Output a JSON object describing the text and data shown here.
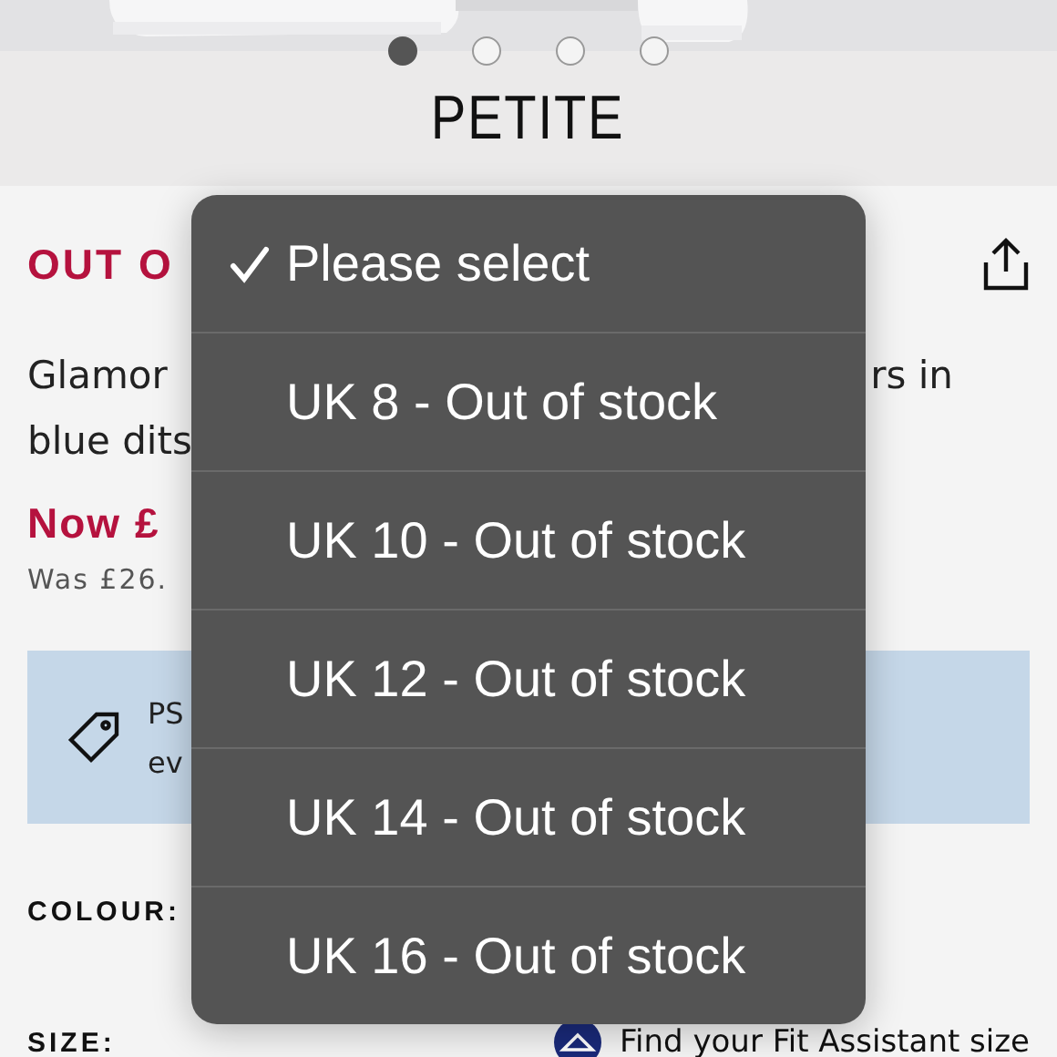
{
  "carousel": {
    "dots": [
      {
        "selected": true
      },
      {
        "selected": false
      },
      {
        "selected": false
      },
      {
        "selected": false
      }
    ]
  },
  "banner": {
    "title": "PETITE"
  },
  "product": {
    "stock_status": "OUT O",
    "description_left": [
      "Glamor",
      "blue dits"
    ],
    "description_right": "rs in",
    "price_now": "Now £",
    "price_was": "Was £26.",
    "promo": {
      "lines": [
        "PS",
        "ev"
      ]
    },
    "colour_label": "COLOUR:",
    "size_label": "SIZE:",
    "fit_assistant_link": "Find your Fit Assistant size"
  },
  "size_menu": {
    "options": [
      {
        "label": "Please select",
        "selected": true
      },
      {
        "label": "UK 8 - Out of stock",
        "selected": false
      },
      {
        "label": "UK 10 - Out of stock",
        "selected": false
      },
      {
        "label": "UK 12 - Out of stock",
        "selected": false
      },
      {
        "label": "UK 14 - Out of stock",
        "selected": false
      },
      {
        "label": "UK 16 - Out of stock",
        "selected": false
      }
    ]
  }
}
